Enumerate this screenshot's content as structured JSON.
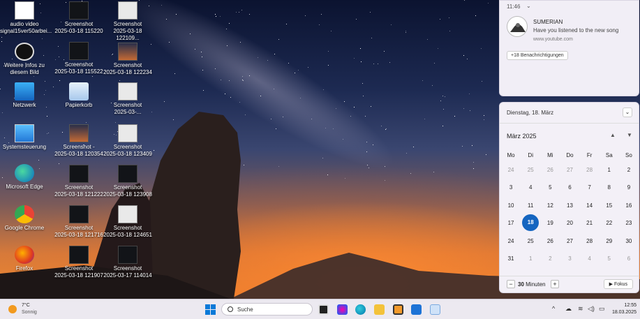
{
  "desktop": {
    "icons": [
      {
        "name": "audio-video-file-icon",
        "label": "audio video\nsignal15ver50arbei..."
      },
      {
        "name": "info-icon",
        "label": "Weitere Infos zu\ndiesem Bild"
      },
      {
        "name": "network-icon",
        "label": "Netzwerk"
      },
      {
        "name": "control-panel-icon",
        "label": "Systemsteuerung"
      },
      {
        "name": "edge-icon",
        "label": "Microsoft Edge"
      },
      {
        "name": "chrome-icon",
        "label": "Google Chrome"
      },
      {
        "name": "firefox-icon",
        "label": "Firefox"
      },
      {
        "name": "screenshot-file-icon",
        "label": "Screenshot\n2025-03-18 115220"
      },
      {
        "name": "screenshot-file-icon",
        "label": "Screenshot\n2025-03-18 115522"
      },
      {
        "name": "recycle-bin-icon",
        "label": "Papierkorb"
      },
      {
        "name": "screenshot-file-icon",
        "label": "Screenshot -\n2025-03-18 120354"
      },
      {
        "name": "screenshot-file-icon",
        "label": "Screenshot\n2025-03-18 121222"
      },
      {
        "name": "screenshot-file-icon",
        "label": "Screenshot\n2025-03-18 121716"
      },
      {
        "name": "screenshot-file-icon",
        "label": "Screenshot\n2025-03-18 121907"
      },
      {
        "name": "screenshot-file-icon",
        "label": "Screenshot\n2025-03-18 122109..."
      },
      {
        "name": "screenshot-file-icon",
        "label": "Screenshot\n2025-03-18 122234"
      },
      {
        "name": "screenshot-file-icon",
        "label": "Screenshot\n2025-03-..."
      },
      {
        "name": "screenshot-file-icon",
        "label": "Screenshot\n2025-03-18 123409"
      },
      {
        "name": "screenshot-file-icon",
        "label": "Screenshot\n2025-03-18 123908"
      },
      {
        "name": "screenshot-file-icon",
        "label": "Screenshot\n2025-03-18 124651"
      },
      {
        "name": "screenshot-file-icon",
        "label": "Screenshot\n2025-03-17 114014"
      }
    ]
  },
  "notification": {
    "time": "11:46",
    "title": "SUMERIAN",
    "message": "Have you listened to the new song",
    "source": "www.youtube.com",
    "more": "+18 Benachrichtigungen"
  },
  "calendar": {
    "header": "Dienstag, 18. März",
    "collapse_icon": "chevron-down-icon",
    "month": "März 2025",
    "weekdays": [
      "Mo",
      "Di",
      "Mi",
      "Do",
      "Fr",
      "Sa",
      "So"
    ],
    "days": [
      [
        "24",
        "dim"
      ],
      [
        "25",
        "dim"
      ],
      [
        "26",
        "dim"
      ],
      [
        "27",
        "dim"
      ],
      [
        "28",
        "dim"
      ],
      [
        "1",
        "day"
      ],
      [
        "2",
        "day"
      ],
      [
        "3",
        "day"
      ],
      [
        "4",
        "day"
      ],
      [
        "5",
        "day"
      ],
      [
        "6",
        "day"
      ],
      [
        "7",
        "day"
      ],
      [
        "8",
        "day"
      ],
      [
        "9",
        "day"
      ],
      [
        "10",
        "day"
      ],
      [
        "11",
        "day"
      ],
      [
        "12",
        "day"
      ],
      [
        "13",
        "day"
      ],
      [
        "14",
        "day"
      ],
      [
        "15",
        "day"
      ],
      [
        "16",
        "day"
      ],
      [
        "17",
        "day"
      ],
      [
        "18",
        "today"
      ],
      [
        "19",
        "day"
      ],
      [
        "20",
        "day"
      ],
      [
        "21",
        "day"
      ],
      [
        "22",
        "day"
      ],
      [
        "23",
        "day"
      ],
      [
        "24",
        "day"
      ],
      [
        "25",
        "day"
      ],
      [
        "26",
        "day"
      ],
      [
        "27",
        "day"
      ],
      [
        "28",
        "day"
      ],
      [
        "29",
        "day"
      ],
      [
        "30",
        "day"
      ],
      [
        "31",
        "day"
      ],
      [
        "1",
        "dim"
      ],
      [
        "2",
        "dim"
      ],
      [
        "3",
        "dim"
      ],
      [
        "4",
        "dim"
      ],
      [
        "5",
        "dim"
      ],
      [
        "6",
        "dim"
      ]
    ],
    "focus_minutes": "30",
    "focus_unit": "Minuten",
    "focus_button": "Fokus",
    "accent": "#1565c0"
  },
  "taskbar": {
    "weather_temp": "7°C",
    "weather_desc": "Sonnig",
    "search_placeholder": "Suche",
    "time": "12:55",
    "date": "18.03.2025"
  }
}
